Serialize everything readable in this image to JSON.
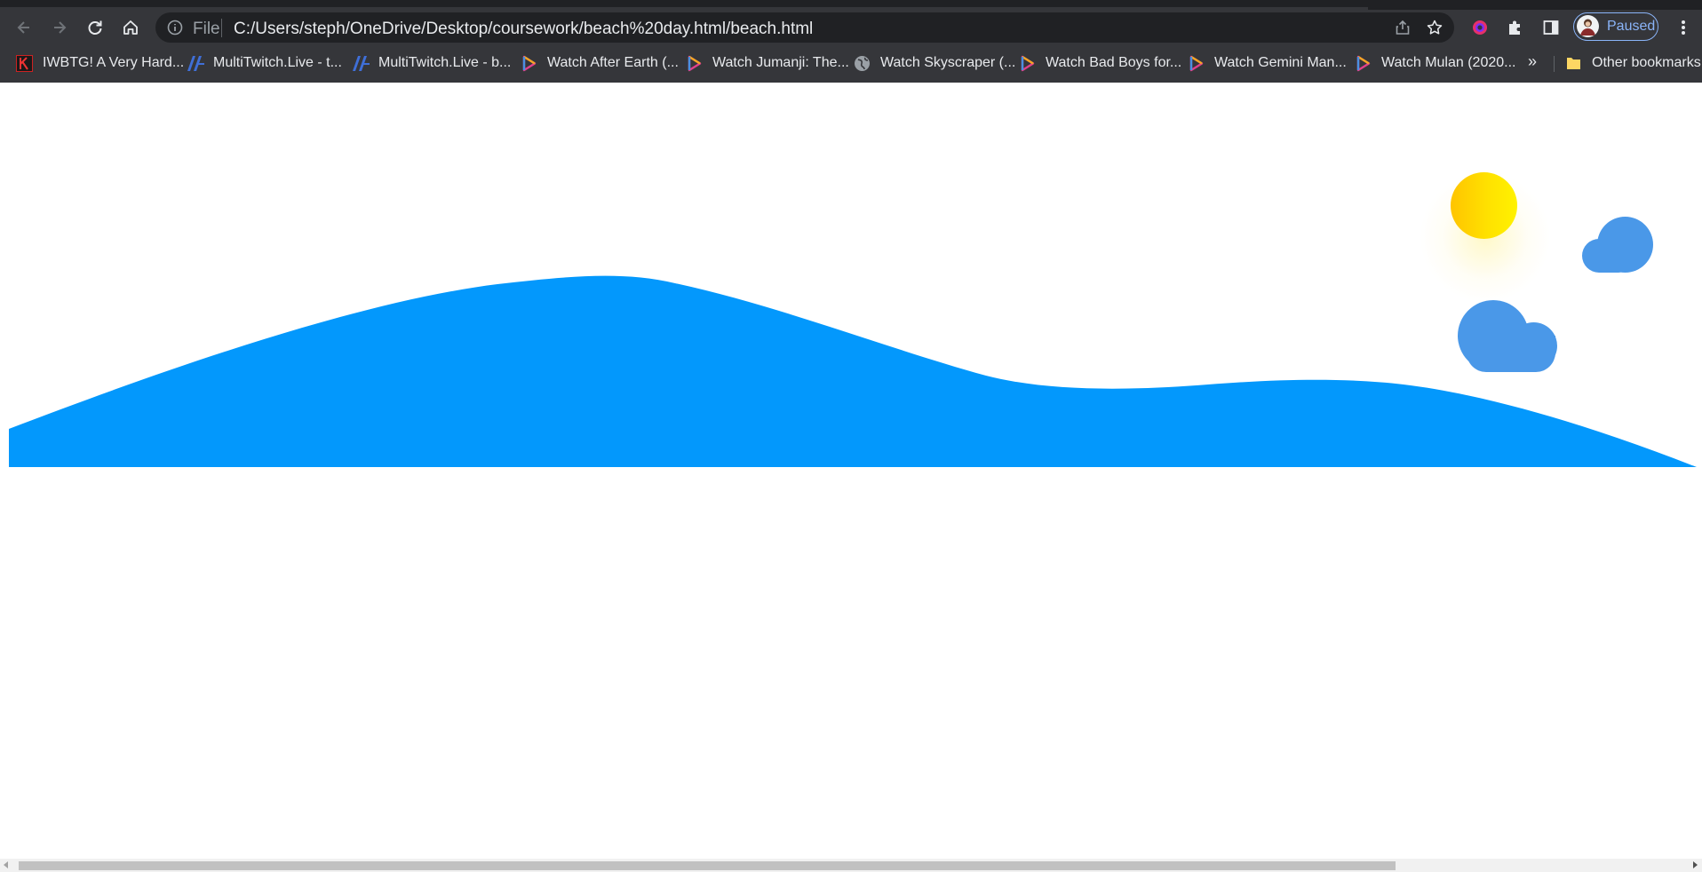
{
  "browser": {
    "scheme_label": "File",
    "url": "C:/Users/steph/OneDrive/Desktop/coursework/beach%20day.html/beach.html",
    "profile_label": "Paused",
    "bookmarks": [
      {
        "label": "IWBTG! A Very Hard...",
        "icon": "k-logo-icon"
      },
      {
        "label": "MultiTwitch.Live - t...",
        "icon": "multitwitch-icon"
      },
      {
        "label": "MultiTwitch.Live - b...",
        "icon": "multitwitch-icon"
      },
      {
        "label": "Watch After Earth (...",
        "icon": "play-icon"
      },
      {
        "label": "Watch Jumanji: The...",
        "icon": "play-icon"
      },
      {
        "label": "Watch Skyscraper (...",
        "icon": "globe-icon"
      },
      {
        "label": "Watch Bad Boys for...",
        "icon": "play-icon"
      },
      {
        "label": "Watch Gemini Man...",
        "icon": "play-icon"
      },
      {
        "label": "Watch Mulan (2020...",
        "icon": "play-icon"
      }
    ],
    "more_bookmarks": "»",
    "other_bookmarks": "Other bookmarks"
  },
  "scene": {
    "wave_color": "#0398fc",
    "sun_colors": [
      "#ffc400",
      "#fff200"
    ],
    "cloud_color": "#4a98e8",
    "background": "#ffffff"
  }
}
